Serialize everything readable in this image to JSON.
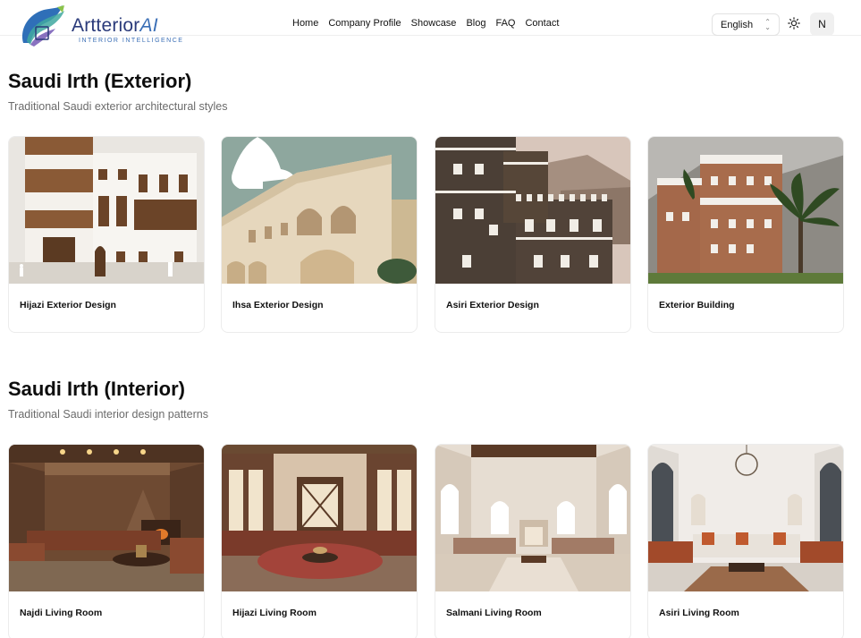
{
  "brand": {
    "name_main": "Artterior",
    "name_ai": "AI",
    "tagline": "INTERIOR INTELLIGENCE"
  },
  "nav": {
    "items": [
      "Home",
      "Company Profile",
      "Showcase",
      "Blog",
      "FAQ",
      "Contact"
    ]
  },
  "header": {
    "language": "English",
    "avatar_initial": "N"
  },
  "sections": [
    {
      "title": "Saudi Irth (Exterior)",
      "subtitle": "Traditional Saudi exterior architectural styles",
      "cards": [
        {
          "label": "Hijazi Exterior Design"
        },
        {
          "label": "Ihsa Exterior Design"
        },
        {
          "label": "Asiri Exterior Design"
        },
        {
          "label": "Exterior Building"
        }
      ]
    },
    {
      "title": "Saudi Irth (Interior)",
      "subtitle": "Traditional Saudi interior design patterns",
      "cards": [
        {
          "label": "Najdi Living Room"
        },
        {
          "label": "Hijazi Living Room"
        },
        {
          "label": "Salmani Living Room"
        },
        {
          "label": "Asiri Living Room"
        }
      ]
    }
  ]
}
